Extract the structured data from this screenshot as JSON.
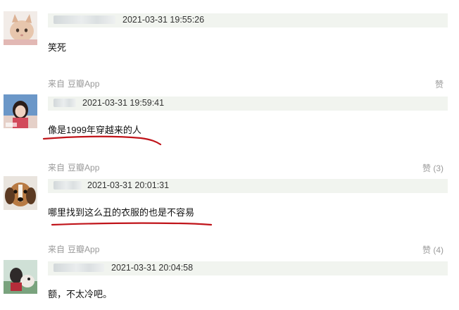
{
  "comments": [
    {
      "timestamp": "2021-03-31 19:55:26",
      "text": "笑死",
      "source_prefix": "来自",
      "source_app": "豆瓣App",
      "like": "赞"
    },
    {
      "timestamp": "2021-03-31 19:59:41",
      "text": "像是1999年穿越来的人",
      "source_prefix": "来自",
      "source_app": "豆瓣App",
      "like": "赞 (3)"
    },
    {
      "timestamp": "2021-03-31 20:01:31",
      "text": "哪里找到这么丑的衣服的也是不容易",
      "source_prefix": "来自",
      "source_app": "豆瓣App",
      "like": "赞 (4)"
    },
    {
      "timestamp": "2021-03-31 20:04:58",
      "text": "额，不太冷吧。"
    }
  ],
  "colors": {
    "meta_bar": "#f1f4ef",
    "underline": "#c0141a",
    "muted_text": "#9a9a9a"
  }
}
